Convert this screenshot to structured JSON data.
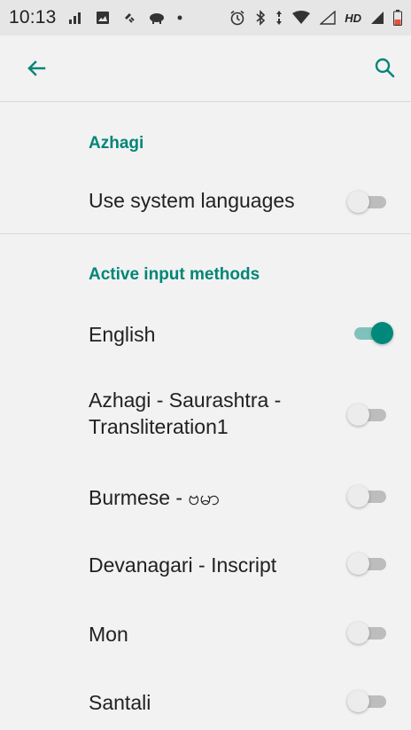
{
  "status_bar": {
    "time": "10:13",
    "hd_label": "HD",
    "left_icons": [
      "signal-bars-icon",
      "image-icon",
      "satellite-icon",
      "cloud-icon",
      "dot-icon"
    ],
    "right_icons": [
      "alarm-icon",
      "bluetooth-icon",
      "data-arrows-icon",
      "wifi-icon",
      "signal-icon",
      "signal-icon",
      "battery-icon"
    ]
  },
  "app_bar": {
    "back_icon": "arrow-left-icon",
    "search_icon": "search-icon"
  },
  "sections": {
    "azhagi": {
      "header": "Azhagi",
      "use_system_languages": {
        "label": "Use system languages",
        "enabled": false
      }
    },
    "active_input_methods": {
      "header": "Active input methods",
      "items": [
        {
          "label": "English",
          "enabled": true
        },
        {
          "label": "Azhagi - Saurashtra - Transliteration1",
          "enabled": false
        },
        {
          "label": "Burmese - ဗမာ",
          "enabled": false
        },
        {
          "label": "Devanagari - Inscript",
          "enabled": false
        },
        {
          "label": "Mon",
          "enabled": false
        },
        {
          "label": "Santali",
          "enabled": false
        }
      ]
    }
  },
  "colors": {
    "accent": "#008577",
    "switch_on_thumb": "#00897b",
    "switch_on_track": "#7fc2bb",
    "switch_off_track": "#bdbdbd",
    "background": "#f2f2f2"
  }
}
